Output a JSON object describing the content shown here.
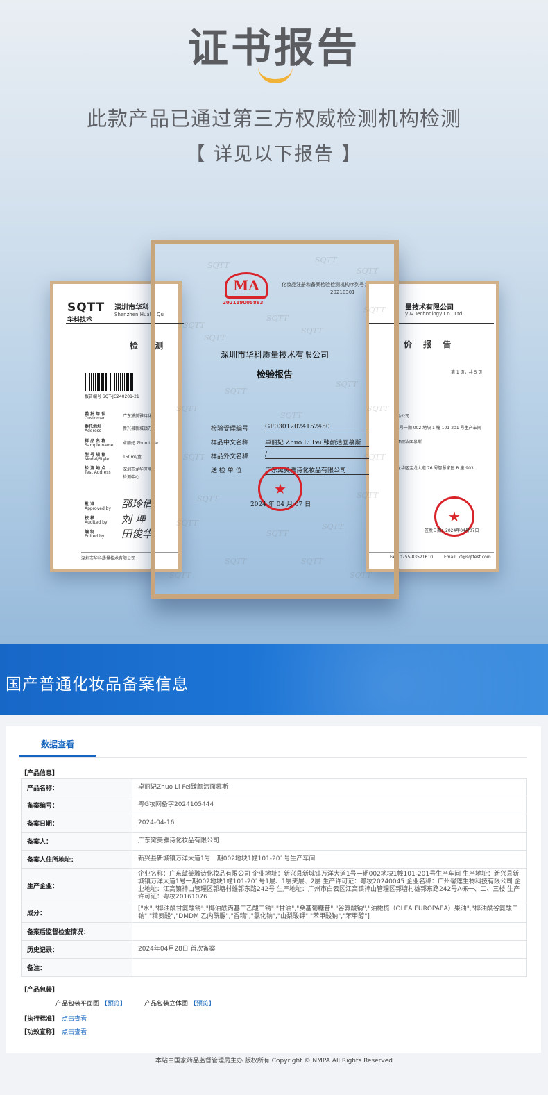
{
  "hero": {
    "title": "证书报告",
    "subtitle": "此款产品已通过第三方权威检测机构检测",
    "subtitle2": "【 详见以下报告 】"
  },
  "cert_left": {
    "logo": "SQTT",
    "logo_cn": "华科技术",
    "company": "深圳市华科",
    "company_en": "Shenzhen Huake Qu",
    "heading": "检 测",
    "barcode_no": "报告编号 SQT-JC240201-21",
    "fields": [
      {
        "label": "委 托 单 位",
        "label_en": "Customer",
        "value": "广东黛美雅诗化"
      },
      {
        "label": "委托地址",
        "label_en": "Address",
        "value": "新兴县新城镇万"
      },
      {
        "label": "样 品 名 称",
        "label_en": "Sample name",
        "value": "卓丽妃 Zhuo Li Fe"
      },
      {
        "label": "型 号 规 格",
        "label_en": "Model/Style",
        "value": "150ml/盒"
      },
      {
        "label": "检 测 地 点",
        "label_en": "Test Address",
        "value": "深圳市龙华区宝"
      },
      {
        "label": "",
        "label_en": "",
        "value": "检测中心"
      }
    ],
    "signatures": [
      {
        "label": "批 准",
        "label_en": "Approved by",
        "sign": "邵玲倩"
      },
      {
        "label": "校 核",
        "label_en": "Audited by",
        "sign": "刘 坤"
      },
      {
        "label": "编 制",
        "label_en": "Edited by",
        "sign": "田俊华"
      }
    ],
    "footer": "深圳市华科质量技术有限公司"
  },
  "cert_center": {
    "cma": "MA",
    "cma_no": "202119005883",
    "note": "化妆品注册和备案检验检测机构序列号：",
    "note_no": "20210301",
    "watermark": "SQTT",
    "company": "深圳市华科质量技术有限公司",
    "title": "检验报告",
    "rows": [
      {
        "label": "检验受理编号",
        "value": "GF03012024152450"
      },
      {
        "label": "样品中文名称",
        "value": "卓丽妃 Zhuo Li Fei 臻颜洁面慕斯"
      },
      {
        "label": "样品外文名称",
        "value": "/"
      },
      {
        "label": "送 检 单 位",
        "value": "广东黛美雅诗化妆品有限公司"
      }
    ],
    "date": "2024 年 04 月 07 日"
  },
  "cert_right": {
    "company": "量技术有限公司",
    "company_en": "y & Technology Co., Ltd",
    "heading": "价 报 告",
    "page": "第 1 页，共 5 页",
    "lines": [
      "品公司",
      "1号一期 002 地块 1 幢 101-201 号生产车间",
      "臻颜洁面慕斯",
      "龙华区宝龙大道 76 号智慧家园 B 座 903"
    ],
    "seal_text": "签发日期：2024年04月07日",
    "footer_left": "Fax: 0755-83521610",
    "footer_right": "Email: kf@sqttest.com"
  },
  "banner": {
    "title": "国产普通化妆品备案信息"
  },
  "record": {
    "tab": "数据查看",
    "section_product": "【产品信息】",
    "rows": [
      {
        "key": "产品名称：",
        "value": "卓丽妃Zhuo Li Fei臻颜洁面慕斯"
      },
      {
        "key": "备案编号：",
        "value": "粤G妆网备字2024105444"
      },
      {
        "key": "备案日期：",
        "value": "2024-04-16"
      },
      {
        "key": "备案人：",
        "value": "广东黛美雅诗化妆品有限公司"
      },
      {
        "key": "备案人住所地址：",
        "value": "新兴县新城镇万洋大道1号一期002地块1幢101-201号生产车间"
      },
      {
        "key": "生产企业：",
        "value": "企业名称：广东黛美雅诗化妆品有限公司 企业地址：新兴县新城镇万洋大道1号一期002地块1幢101-201号生产车间 生产地址：新兴县新城镇万洋大道1号一期002地块1幢101-201号1层、1层夹层、2层 生产许可证：粤妆20240045 企业名称：广州馨莲生物科技有限公司 企业地址：江高镇神山管理区郭塘村雄郭东路242号 生产地址：广州市白云区江高镇神山管理区郭塘村雄郭东路242号A栋一、二、三楼 生产许可证：粤妆20161076"
      },
      {
        "key": "成分：",
        "value": "[\"水\",\"椰油酰甘氨酸钠\",\"椰油酰丙基二乙酸二钠\",\"甘油\",\"癸基葡糖苷\",\"谷氨酸钠\",\"油橄榄（OLEA EUROPAEA）果油\",\"椰油酰谷氨酸二钠\",\"精氨酸\",\"DMDM 乙内酰脲\",\"香精\",\"氯化钠\",\"山梨酸钾\",\"苯甲酸钠\",\"苯甲醇\"]"
      },
      {
        "key": "备案后监督检查情况：",
        "value": ""
      },
      {
        "key": "历史记录：",
        "value": "2024年04月28日 首次备案"
      },
      {
        "key": "备注：",
        "value": ""
      }
    ],
    "section_pack": "【产品包装】",
    "pack_flat": "产品包装平面图",
    "pack_3d": "产品包装立体图",
    "preview": "【预览】",
    "section_standard": "【执行标准】",
    "section_claim": "【功效宣称】",
    "click_view": "点击查看"
  },
  "footer": "本站由国家药品监督管理局主办 版权所有 Copyright © NMPA All Rights Reserved"
}
